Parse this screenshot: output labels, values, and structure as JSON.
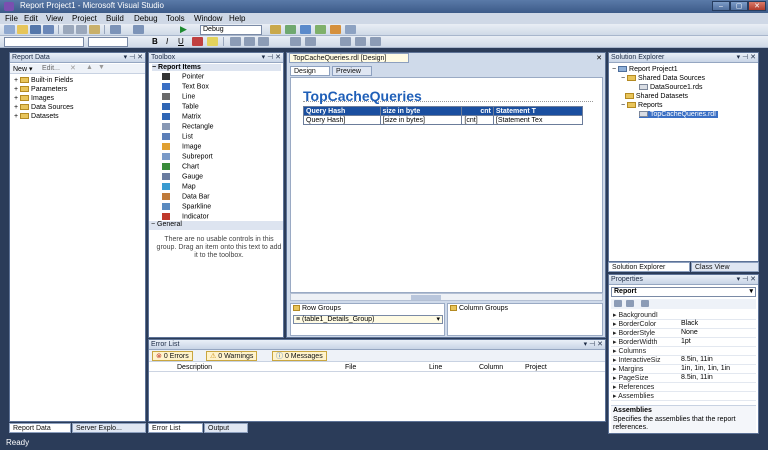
{
  "window": {
    "title": "Report Project1 - Microsoft Visual Studio",
    "minimize": "–",
    "maximize": "▢",
    "close": "✕"
  },
  "menu": [
    "File",
    "Edit",
    "View",
    "Project",
    "Build",
    "Debug",
    "Tools",
    "Window",
    "Help"
  ],
  "toolbar": {
    "config": "Debug"
  },
  "report_data": {
    "title": "Report Data",
    "new_label": "New ▾",
    "edit_label": "Edit...",
    "items": [
      "Built-in Fields",
      "Parameters",
      "Images",
      "Data Sources",
      "Datasets"
    ]
  },
  "toolbox": {
    "title": "Toolbox",
    "group": "Report Items",
    "items": [
      "Pointer",
      "Text Box",
      "Line",
      "Table",
      "Matrix",
      "Rectangle",
      "List",
      "Image",
      "Subreport",
      "Chart",
      "Gauge",
      "Map",
      "Data Bar",
      "Sparkline",
      "Indicator"
    ],
    "general": "General",
    "general_msg": "There are no usable controls in this group. Drag an item onto this text to add it to the toolbox."
  },
  "designer": {
    "tab": "TopCacheQueries.rdl [Design]",
    "design_tab": "Design",
    "preview_tab": "Preview",
    "report_title": "TopCacheQueries",
    "table_headers": [
      "Query Hash",
      "size in byte",
      "cnt",
      "Statement T"
    ],
    "table_row": [
      "Query Hash]",
      "[size in bytes]",
      "[cnt]",
      "[Statement Tex"
    ],
    "row_groups_label": "Row Groups",
    "column_groups_label": "Column Groups",
    "row_group_value": "(table1_Details_Group)"
  },
  "error_list": {
    "title": "Error List",
    "errors": "0 Errors",
    "warnings": "0 Warnings",
    "messages": "0 Messages",
    "columns": [
      "Description",
      "File",
      "Line",
      "Column",
      "Project"
    ]
  },
  "bottom_tabs": {
    "report_data": "Report Data",
    "server_explorer": "Server Explo...",
    "error_list": "Error List",
    "output": "Output"
  },
  "solution_explorer": {
    "title": "Solution Explorer",
    "project": "Report Project1",
    "shared_ds": "Shared Data Sources",
    "ds_file": "DataSource1.rds",
    "shared_datasets": "Shared Datasets",
    "reports": "Reports",
    "report_file": "TopCacheQueries.rdl",
    "tab1": "Solution Explorer",
    "tab2": "Class View"
  },
  "properties": {
    "title": "Properties",
    "object": "Report",
    "rows": [
      {
        "name": "BackgroundI",
        "value": ""
      },
      {
        "name": "BorderColor",
        "value": "Black"
      },
      {
        "name": "BorderStyle",
        "value": "None"
      },
      {
        "name": "BorderWidth",
        "value": "1pt"
      },
      {
        "name": "Columns",
        "value": ""
      },
      {
        "name": "InteractiveSiz",
        "value": "8.5in, 11in"
      },
      {
        "name": "Margins",
        "value": "1in, 1in, 1in, 1in"
      },
      {
        "name": "PageSize",
        "value": "8.5in, 11in"
      },
      {
        "name": "References",
        "value": ""
      },
      {
        "name": "Assemblies",
        "value": ""
      }
    ],
    "desc_title": "Assemblies",
    "desc_text": "Specifies the assemblies that the report references."
  },
  "status": "Ready",
  "colors": {
    "accent_title": "#1f5fb8",
    "header_blue": "#1a4fa0"
  }
}
